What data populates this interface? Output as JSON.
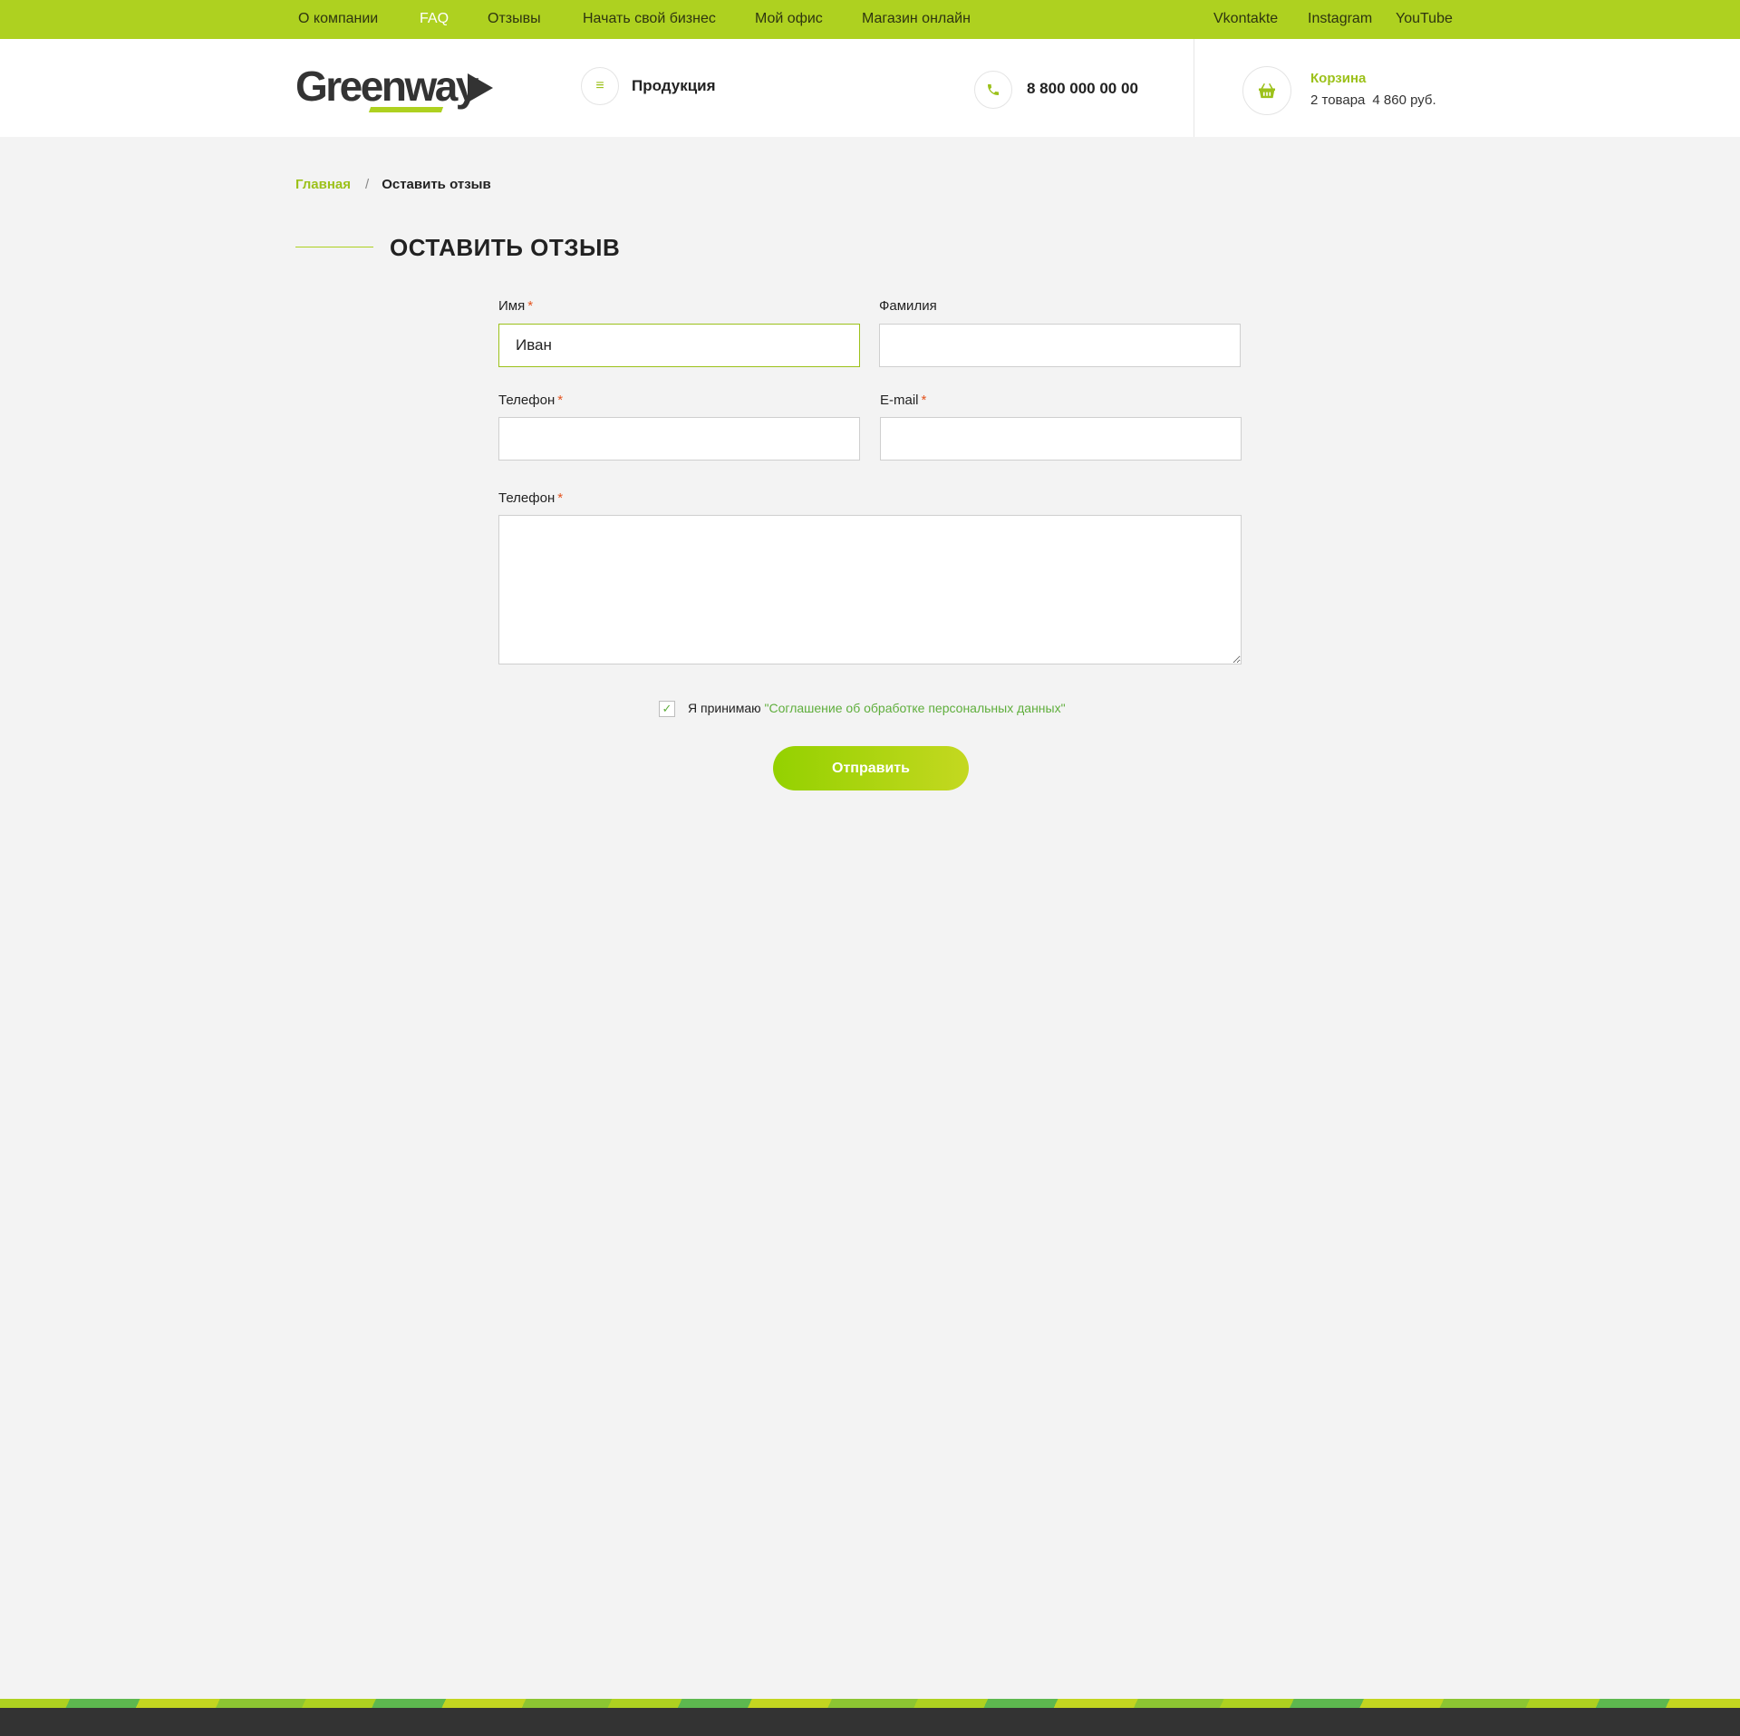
{
  "topnav": {
    "items": [
      {
        "label": "О компании"
      },
      {
        "label": "FAQ"
      },
      {
        "label": "Отзывы"
      },
      {
        "label": "Начать свой бизнес"
      },
      {
        "label": "Мой офис"
      },
      {
        "label": "Магазин онлайн"
      }
    ],
    "active": "FAQ",
    "social": [
      {
        "label": "Vkontakte"
      },
      {
        "label": "Instagram"
      },
      {
        "label": "YouTube"
      }
    ]
  },
  "header": {
    "logo_text": "Greenway",
    "products_label": "Продукция",
    "phone": "8 800 000 00 00",
    "cart": {
      "title": "Корзина",
      "count": "2 товара",
      "total": "4 860 руб."
    }
  },
  "breadcrumb": {
    "home": "Главная",
    "separator": "/",
    "current": "Оставить отзыв"
  },
  "page": {
    "title": "ОСТАВИТЬ ОТЗЫВ"
  },
  "form": {
    "first_name": {
      "label": "Имя",
      "required": "*",
      "value": "Иван"
    },
    "last_name": {
      "label": "Фамилия",
      "value": ""
    },
    "phone": {
      "label": "Телефон",
      "required": "*",
      "value": ""
    },
    "email": {
      "label": "E-mail",
      "required": "*",
      "value": ""
    },
    "message": {
      "label": "Телефон",
      "required": "*",
      "value": ""
    },
    "consent": {
      "checked": true,
      "text": "Я принимаю",
      "link": "\"Соглашение об обработке персональных данных\""
    },
    "submit_label": "Отправить"
  },
  "colors": {
    "accent": "#aed120",
    "accent_text": "#9cc11a",
    "link_green": "#5fae3c",
    "required": "#e4541f",
    "footer": "#333333"
  },
  "icons": {
    "products": "menu-icon",
    "phone": "phone-icon",
    "cart": "basket-icon",
    "consent": "check-icon"
  }
}
